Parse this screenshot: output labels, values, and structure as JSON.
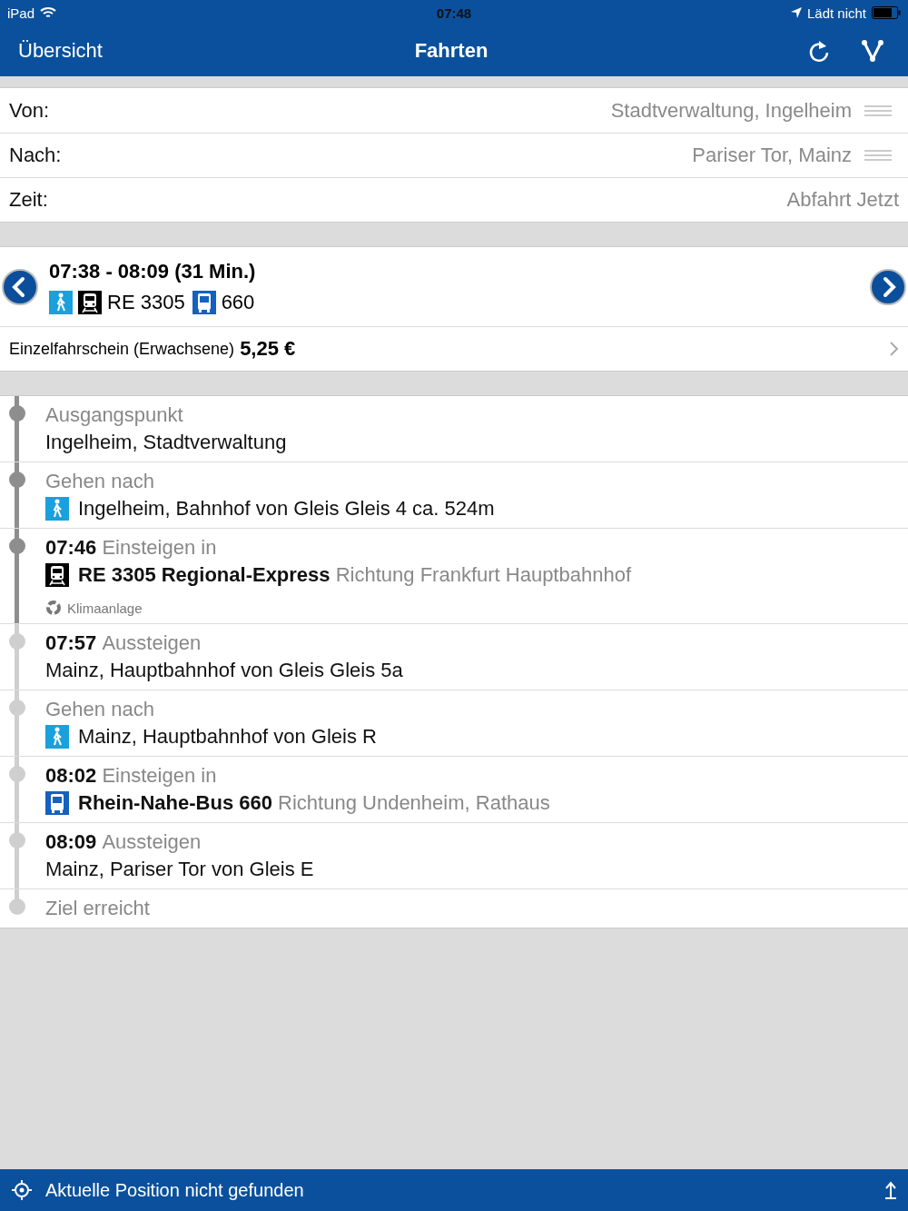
{
  "status_bar": {
    "device": "iPad",
    "time": "07:48",
    "charging": "Lädt nicht"
  },
  "nav": {
    "back": "Übersicht",
    "title": "Fahrten"
  },
  "form": [
    {
      "label": "Von:",
      "value": "Stadtverwaltung, Ingelheim",
      "reorder": true
    },
    {
      "label": "Nach:",
      "value": "Pariser Tor, Mainz",
      "reorder": true
    },
    {
      "label": "Zeit:",
      "value": "Abfahrt Jetzt",
      "reorder": false
    }
  ],
  "trip": {
    "times": "07:38 - 08:09 (31 Min.)",
    "legs": [
      {
        "kind": "walk"
      },
      {
        "kind": "train",
        "label": "RE 3305"
      },
      {
        "kind": "bus",
        "label": "660"
      }
    ],
    "fare_label": "Einzelfahrschein (Erwachsene)",
    "fare_price": "5,25 €"
  },
  "steps": [
    {
      "kind": "info",
      "passed": true,
      "action": "Ausgangspunkt",
      "detail": "Ingelheim, Stadtverwaltung"
    },
    {
      "kind": "walk",
      "passed": true,
      "action": "Gehen nach",
      "detail": "Ingelheim, Bahnhof von Gleis Gleis 4 ca. 524m"
    },
    {
      "kind": "train",
      "passed": true,
      "time": "07:46",
      "action": "Einsteigen in",
      "line": "RE 3305 Regional-Express",
      "direction": "Richtung Frankfurt Hauptbahnhof",
      "feature": "Klimaanlage"
    },
    {
      "kind": "info",
      "passed": false,
      "time": "07:57",
      "action": "Aussteigen",
      "detail": "Mainz, Hauptbahnhof von Gleis Gleis 5a"
    },
    {
      "kind": "walk",
      "passed": false,
      "action": "Gehen nach",
      "detail": "Mainz, Hauptbahnhof von Gleis R"
    },
    {
      "kind": "bus",
      "passed": false,
      "time": "08:02",
      "action": "Einsteigen in",
      "line": "Rhein-Nahe-Bus 660",
      "direction": "Richtung Undenheim, Rathaus"
    },
    {
      "kind": "info",
      "passed": false,
      "time": "08:09",
      "action": "Aussteigen",
      "detail": "Mainz, Pariser Tor von Gleis E"
    },
    {
      "kind": "end",
      "passed": false,
      "action": "Ziel erreicht"
    }
  ],
  "footer": {
    "message": "Aktuelle Position nicht gefunden"
  }
}
